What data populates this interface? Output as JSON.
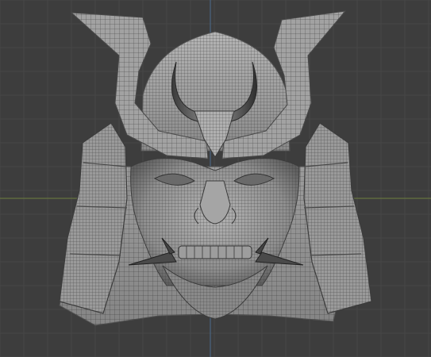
{
  "viewport": {
    "background": "#3d3d3d",
    "grid_color": "#474747",
    "grid_major_color": "#505050",
    "axis_x_color": "#6f7f40",
    "axis_y_color": "#4a6c8f",
    "wire_color": "#3a3a3a",
    "surface_light": "#a8a8a8",
    "surface_mid": "#8e8e8e",
    "surface_dark": "#5c5c5c"
  },
  "object": {
    "name": "",
    "parts": [
      "helmet-crest-left",
      "helmet-crest-right",
      "helmet-dome",
      "crescent-ornament",
      "brow-plate",
      "face-mask",
      "teeth",
      "chin",
      "fang-left",
      "fang-right",
      "shoulder-guard-left",
      "shoulder-guard-right",
      "neck-guard"
    ]
  }
}
